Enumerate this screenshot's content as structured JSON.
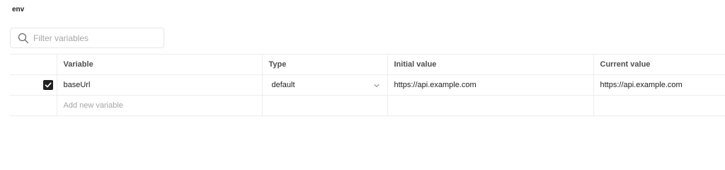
{
  "environment": {
    "name": "env"
  },
  "filter": {
    "placeholder": "Filter variables",
    "icon": "search-icon"
  },
  "table": {
    "headers": [
      "Variable",
      "Type",
      "Initial value",
      "Current value"
    ],
    "rows": [
      {
        "enabled": true,
        "variable": "baseUrl",
        "type": "default",
        "initial_value": "https://api.example.com",
        "current_value": "https://api.example.com"
      }
    ],
    "add_placeholder": "Add new variable"
  }
}
